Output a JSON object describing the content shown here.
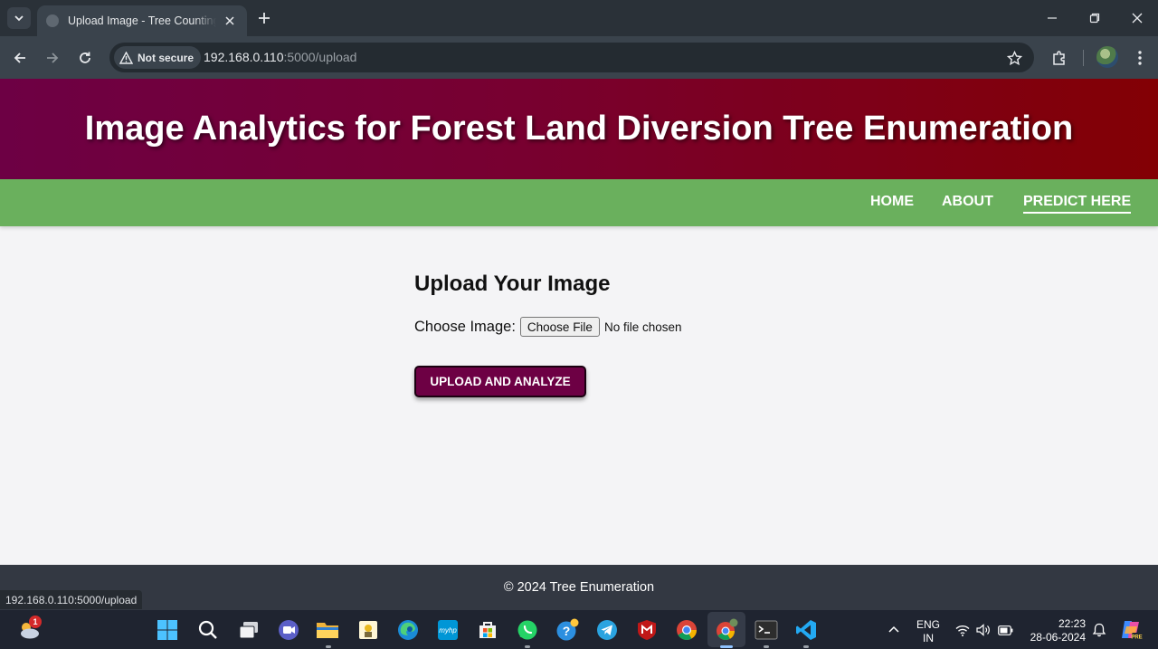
{
  "browser": {
    "tab_title": "Upload Image - Tree Counting System",
    "security_label": "Not secure",
    "url_host": "192.168.0.110",
    "url_path": ":5000/upload",
    "status_url": "192.168.0.110:5000/upload"
  },
  "page": {
    "banner_title": "Image Analytics for Forest Land Diversion Tree Enumeration",
    "nav": [
      {
        "label": "HOME"
      },
      {
        "label": "ABOUT"
      },
      {
        "label": "PREDICT HERE"
      }
    ],
    "upload": {
      "heading": "Upload Your Image",
      "choose_label": "Choose Image:",
      "file_button": "Choose File",
      "file_status": "No file chosen",
      "submit_label": "UPLOAD AND ANALYZE"
    },
    "footer": "© 2024 Tree Enumeration"
  },
  "colors": {
    "banner_start": "#6d0044",
    "banner_end": "#830004",
    "nav_bg": "#6ab05d",
    "button_bg": "#6d0044",
    "footer_bg": "#333842"
  },
  "taskbar": {
    "weather_badge": "1",
    "lang_line1": "ENG",
    "lang_line2": "IN",
    "time": "22:23",
    "date": "28-06-2024",
    "icons": [
      "weather-icon",
      "windows-start-icon",
      "search-icon",
      "task-view-icon",
      "teams-icon",
      "file-explorer-icon",
      "app-icon",
      "edge-icon",
      "myhp-icon",
      "store-icon",
      "whatsapp-icon",
      "help-icon",
      "telegram-icon",
      "mcafee-icon",
      "chrome-icon",
      "chrome-profile-icon",
      "terminal-icon",
      "vscode-icon"
    ]
  }
}
